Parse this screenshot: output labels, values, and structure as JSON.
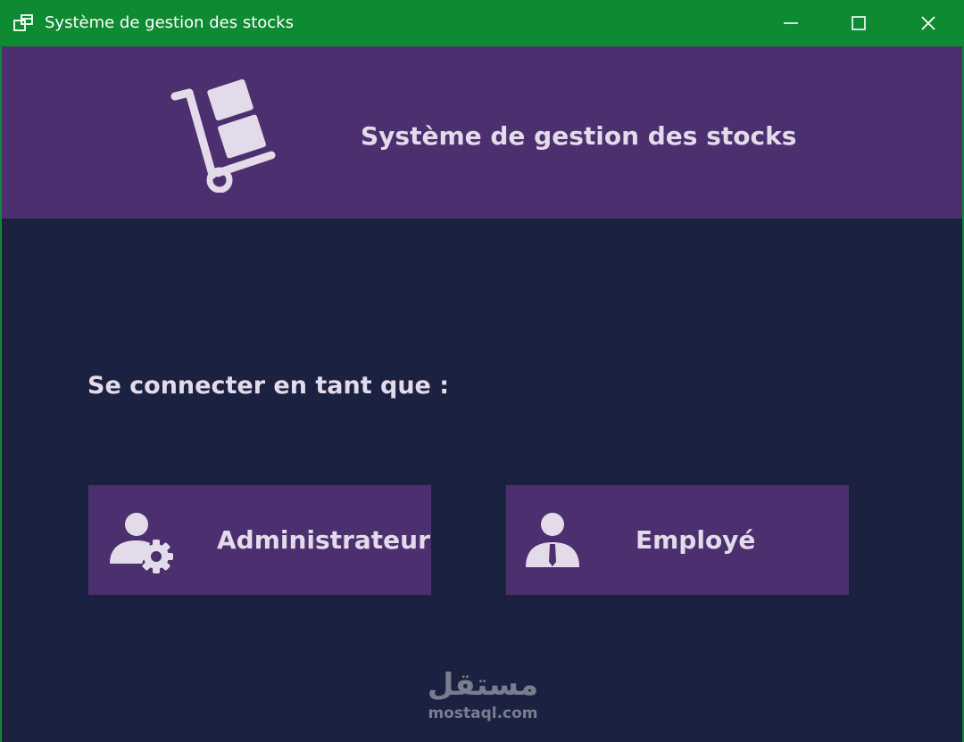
{
  "window": {
    "title": "Système de gestion des stocks",
    "controls": {
      "minimize_icon": "minimize-icon",
      "maximize_icon": "maximize-icon",
      "close_icon": "close-icon"
    }
  },
  "header": {
    "title": "Système de gestion des stocks",
    "icon": "hand-truck-icon"
  },
  "login": {
    "prompt": "Se connecter en tant que :",
    "roles": [
      {
        "label": "Administrateur",
        "icon": "admin-user-gear-icon"
      },
      {
        "label": "Employé",
        "icon": "employee-user-icon"
      }
    ]
  },
  "watermark": {
    "brand_arabic": "مستقل",
    "url": "mostaql.com"
  },
  "colors": {
    "titlebar": "#0e8a32",
    "header": "#4c2f6e",
    "background": "#1b2140",
    "button": "#4c2f6e",
    "text": "#e3dbe9"
  }
}
